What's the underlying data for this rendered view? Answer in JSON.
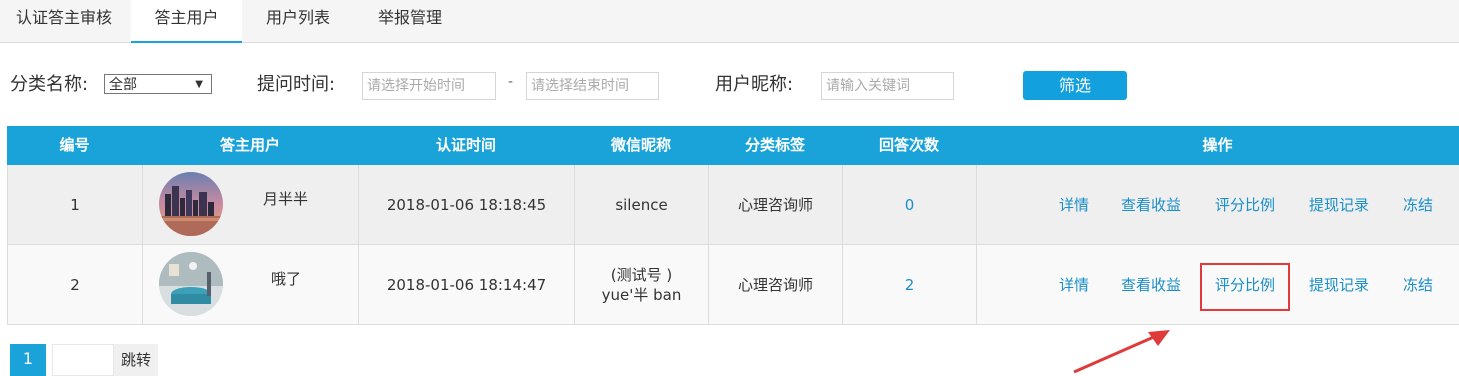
{
  "tabs": [
    {
      "label": "认证答主审核"
    },
    {
      "label": "答主用户"
    },
    {
      "label": "用户列表"
    },
    {
      "label": "举报管理"
    }
  ],
  "filter": {
    "category_label": "分类名称:",
    "category_value": "全部",
    "time_label": "提问时间:",
    "start_placeholder": "请选择开始时间",
    "dash": "-",
    "end_placeholder": "请选择结束时间",
    "nick_label": "用户昵称:",
    "nick_placeholder": "请输入关键词",
    "submit_label": "筛选"
  },
  "table": {
    "headers": [
      "编号",
      "答主用户",
      "认证时间",
      "微信昵称",
      "分类标签",
      "回答次数",
      "操作"
    ],
    "rows": [
      {
        "id": "1",
        "user": "月半半",
        "cert_time": "2018-01-06 18:18:45",
        "wechat_line1": "silence",
        "wechat_line2": "",
        "tag": "心理咨询师",
        "answers": "0"
      },
      {
        "id": "2",
        "user": "哦了",
        "cert_time": "2018-01-06 18:14:47",
        "wechat_line1": "(测试号 )",
        "wechat_line2": "yue'半 ban",
        "tag": "心理咨询师",
        "answers": "2"
      }
    ],
    "actions": [
      "详情",
      "查看收益",
      "评分比例",
      "提现记录",
      "冻结"
    ]
  },
  "pagination": {
    "current_page": "1",
    "go_label": "跳转"
  },
  "colors": {
    "accent": "#1aa3d9",
    "link": "#1a8fcb",
    "highlight": "#e03a3a"
  }
}
